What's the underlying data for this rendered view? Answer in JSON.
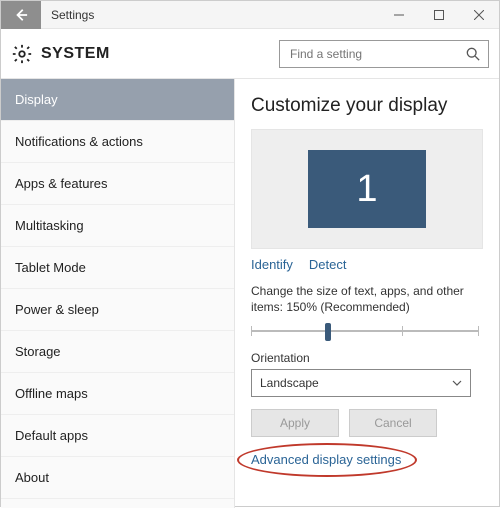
{
  "window": {
    "title": "Settings",
    "system_label": "SYSTEM"
  },
  "search": {
    "placeholder": "Find a setting"
  },
  "sidebar": {
    "items": [
      {
        "label": "Display",
        "active": true
      },
      {
        "label": "Notifications & actions"
      },
      {
        "label": "Apps & features"
      },
      {
        "label": "Multitasking"
      },
      {
        "label": "Tablet Mode"
      },
      {
        "label": "Power & sleep"
      },
      {
        "label": "Storage"
      },
      {
        "label": "Offline maps"
      },
      {
        "label": "Default apps"
      },
      {
        "label": "About"
      }
    ]
  },
  "content": {
    "heading": "Customize your display",
    "monitor_number": "1",
    "identify_link": "Identify",
    "detect_link": "Detect",
    "scale_label": "Change the size of text, apps, and other items: 150% (Recommended)",
    "orientation_label": "Orientation",
    "orientation_value": "Landscape",
    "apply_btn": "Apply",
    "cancel_btn": "Cancel",
    "advanced_link": "Advanced display settings"
  }
}
